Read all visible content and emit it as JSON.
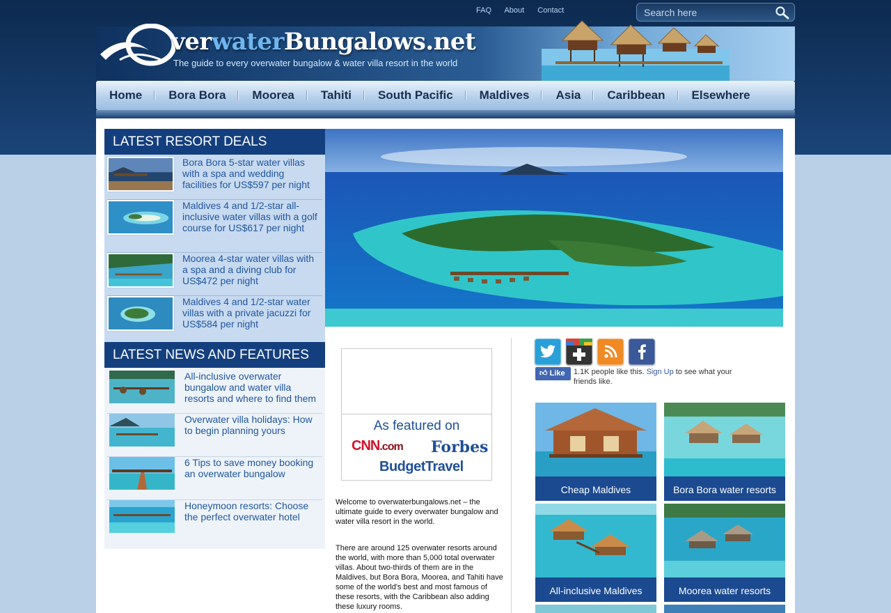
{
  "site": {
    "logo_part1": "O",
    "logo_part2": "ver",
    "logo_part3": "water",
    "logo_part4": "Bungalows.net",
    "tagline": "The guide to every overwater bungalow & water villa resort in the world"
  },
  "toplinks": [
    "FAQ",
    "About",
    "Contact"
  ],
  "search": {
    "placeholder": "Search here"
  },
  "nav": [
    "Home",
    "Bora Bora",
    "Moorea",
    "Tahiti",
    "South Pacific",
    "Maldives",
    "Asia",
    "Caribbean",
    "Elsewhere"
  ],
  "deals": {
    "heading": "LATEST RESORT DEALS",
    "items": [
      "Bora Bora 5-star water villas with a spa and wedding facilities for US$597 per night",
      "Maldives 4 and 1/2-star all-inclusive water villas with a golf course for US$617 per night",
      "Moorea 4-star water villas with a spa and a diving club for US$472 per night",
      "Maldives 4 and 1/2-star water villas with a private jacuzzi for US$584 per night"
    ]
  },
  "news": {
    "heading": "LATEST NEWS AND FEATURES",
    "items": [
      "All-inclusive overwater bungalow and water villa resorts and where to find them",
      "Overwater villa holidays: How to begin planning yours",
      "6 Tips to save money booking an overwater bungalow",
      "Honeymoon resorts: Choose the perfect overwater hotel"
    ]
  },
  "featured": {
    "title": "As featured on",
    "cnn": "CNN",
    "cnn_suffix": ".com",
    "forbes": "Forbes",
    "budget": "BudgetTravel"
  },
  "intro": {
    "welcome": "Welcome to overwaterbungalows.net – the ultimate guide to every overwater bungalow and water villa resort in the world.",
    "body": "There are around 125 overwater resorts around the world, with more than 5,000 total overwater villas. About two-thirds of them are in the Maldives, but Bora Bora, Moorea, and Tahiti have some of the world's best and most famous of these resorts, with the Caribbean also adding these luxury rooms."
  },
  "like": {
    "button": "Like",
    "count_text": "1.1K people like this.",
    "signup": "Sign Up",
    "rest": " to see what your friends like."
  },
  "tiles": [
    "Cheap Maldives",
    "Bora Bora water resorts",
    "All-inclusive Maldives",
    "Moorea water resorts"
  ],
  "colors": {
    "brand_dark": "#143f7e",
    "link": "#1f56a0",
    "tile_caption": "#1b4a91",
    "twitter": "#2a9fd8",
    "googleplus": "#333333",
    "rss": "#f08a24",
    "facebook": "#3b5998"
  }
}
